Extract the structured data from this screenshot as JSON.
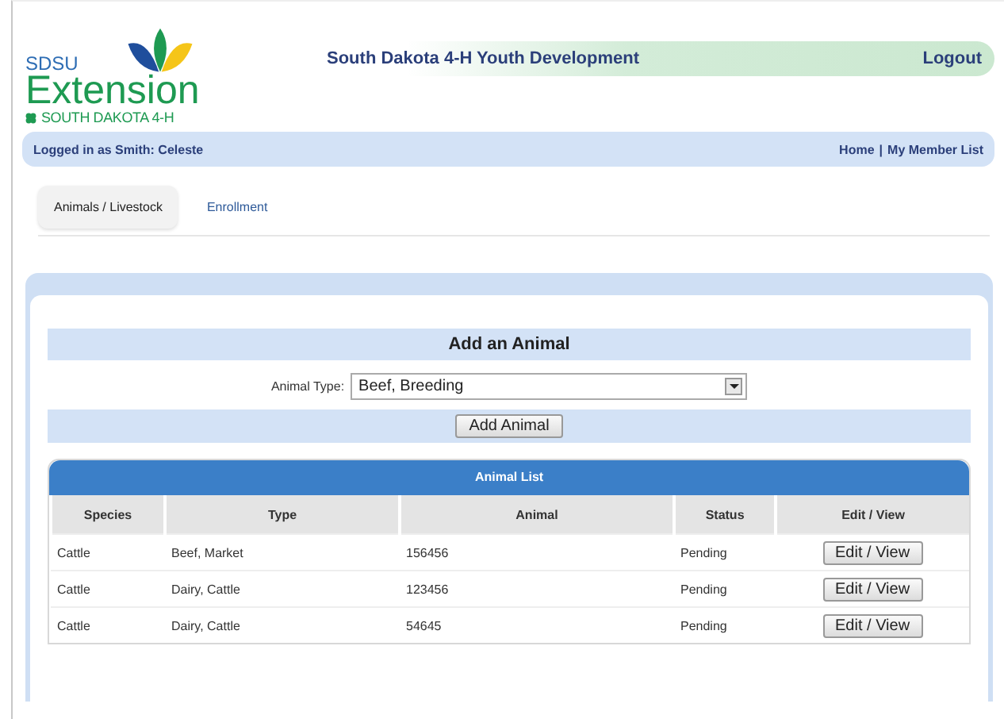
{
  "logo": {
    "top": "SDSU",
    "main": "Extension",
    "sub": "SOUTH DAKOTA 4-H"
  },
  "header": {
    "title": "South Dakota 4-H Youth Development",
    "logout": "Logout"
  },
  "user_bar": {
    "logged_in": "Logged in as Smith: Celeste",
    "links": [
      "Home",
      "My Member List"
    ],
    "separator": "|"
  },
  "tabs": [
    {
      "label": "Animals / Livestock",
      "selected": true
    },
    {
      "label": "Enrollment",
      "selected": false
    }
  ],
  "add_animal": {
    "title": "Add an Animal",
    "field_label": "Animal Type:",
    "value": "Beef, Breeding",
    "button": "Add Animal"
  },
  "animal_list": {
    "title": "Animal List",
    "columns": [
      "Species",
      "Type",
      "Animal",
      "Status",
      "Edit / View"
    ],
    "rows": [
      {
        "species": "Cattle",
        "type": "Beef, Market",
        "animal": "156456",
        "status": "Pending",
        "action": "Edit / View"
      },
      {
        "species": "Cattle",
        "type": "Dairy, Cattle",
        "animal": "123456",
        "status": "Pending",
        "action": "Edit / View"
      },
      {
        "species": "Cattle",
        "type": "Dairy, Cattle",
        "animal": "54645",
        "status": "Pending",
        "action": "Edit / View"
      }
    ]
  }
}
